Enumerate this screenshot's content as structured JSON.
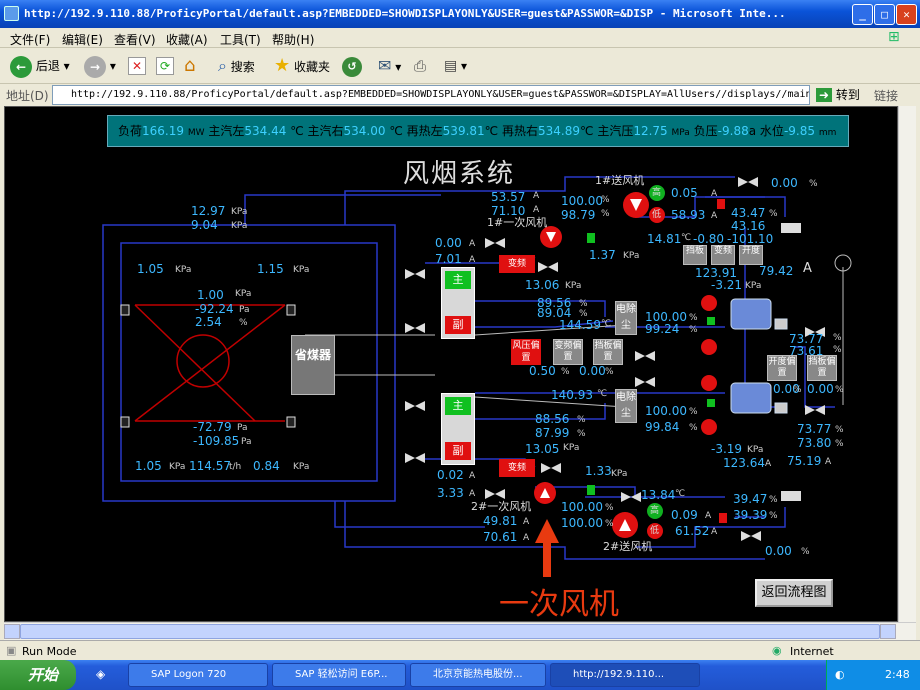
{
  "window": {
    "title": "http://192.9.110.88/ProficyPortal/default.asp?EMBEDDED=SHOWDISPLAYONLY&USER=guest&PASSWOR=&DISP - Microsoft Inte..."
  },
  "menu": [
    "文件(F)",
    "编辑(E)",
    "查看(V)",
    "收藏(A)",
    "工具(T)",
    "帮助(H)"
  ],
  "toolbar": {
    "back": "后退",
    "search": "搜索",
    "favorites": "收藏夹"
  },
  "address": {
    "label": "地址(D)",
    "url": "http://192.9.110.88/ProficyPortal/default.asp?EMBEDDED=SHOWDISPLAYONLY&USER=guest&PASSWOR=&DISPLAY=AllUsers//displays//main&SHUTDOWNLOC",
    "go": "转到",
    "links": "链接"
  },
  "scada": {
    "title": "风烟系统",
    "info": {
      "load_label": "负荷",
      "load": "166.19",
      "load_unit": "MW",
      "ms_left_label": "主汽左",
      "ms_left": "534.44",
      "ms_left_unit": "℃",
      "ms_right_label": "主汽右",
      "ms_right": "534.00",
      "ms_right_unit": "℃",
      "rh_left_label": "再热左",
      "rh_left": "539.81",
      "rh_left_unit": "℃",
      "rh_right_label": "再热右",
      "rh_right": "534.89",
      "rh_right_unit": "℃",
      "ms_pres_label": "主汽压",
      "ms_pres": "12.75",
      "ms_pres_unit": "MPa",
      "neg_label": "负压",
      "neg": "-9.88",
      "neg_unit": "a",
      "level_label": "水位",
      "level": "-9.85",
      "level_unit": "mm"
    },
    "values": {
      "v1": "12.97",
      "v2": "9.04",
      "v3": "1.05",
      "v4": "1.15",
      "v5": "1.00",
      "v6": "-92.24",
      "v7": "2.54",
      "v8": "-72.79",
      "v9": "-109.85",
      "v10": "1.05",
      "v11": "114.57",
      "v12": "0.84",
      "v13": "53.57",
      "v14": "71.10",
      "v15": "100.00",
      "v16": "98.79",
      "v17": "0.05",
      "v18": "58.93",
      "v19": "0.00",
      "v20": "43.47",
      "v21": "43.16",
      "v22": "14.81",
      "v23": "-0.80",
      "v24": "-101.10",
      "v25": "0.00",
      "v26": "7.01",
      "v27": "1.37",
      "v28": "13.06",
      "v29": "123.91",
      "v30": "79.42",
      "v31": "-3.21",
      "v32": "89.56",
      "v33": "89.04",
      "v34": "144.59",
      "v35": "100.00",
      "v36": "99.24",
      "v37": "73.77",
      "v38": "73.61",
      "v39": "0.50",
      "v40": "0.00",
      "v41": "140.93",
      "v42": "0.00",
      "v43": "0.00",
      "v44": "100.00",
      "v45": "99.84",
      "v46": "73.77",
      "v47": "73.80",
      "v48": "-3.19",
      "v49": "123.64",
      "v50": "75.19",
      "v51": "88.56",
      "v52": "87.99",
      "v53": "13.05",
      "v54": "0.02",
      "v55": "3.33",
      "v56": "1.33",
      "v57": "13.84",
      "v58": "39.47",
      "v59": "39.39",
      "v60": "0.09",
      "v61": "61.52",
      "v62": "0.00",
      "v63": "49.81",
      "v64": "70.61",
      "v65": "100.00",
      "v66": "100.00"
    },
    "labels": {
      "fan1_send": "1#送风机",
      "fan1_primary": "1#一次风机",
      "fan2_primary": "2#一次风机",
      "fan2_send": "2#送风机",
      "economizer": "省煤器",
      "pa_bias": "风压偏置",
      "fq_bias1": "变频偏置",
      "baffle_bias1": "挡板偏置",
      "open_bias": "开度偏置",
      "baffle_bias2": "挡板偏置",
      "vfd1": "变频",
      "vfd2": "变频",
      "main": "主",
      "aux": "副",
      "high": "高",
      "low": "低",
      "dust1": "电除尘",
      "dust2": "电除尘",
      "gbox1": "挡板",
      "gbox2": "变频",
      "gbox3": "开度"
    },
    "return_button": "返回流程图",
    "annotation": "一次风机"
  },
  "status": {
    "text": "Run Mode",
    "zone": "Internet"
  },
  "taskbar": {
    "start": "开始",
    "items": [
      "SAP Logon 720",
      "SAP 轻松访问 E6P...",
      "北京京能热电股份...",
      "http://192.9.110..."
    ],
    "clock": "2:48"
  }
}
